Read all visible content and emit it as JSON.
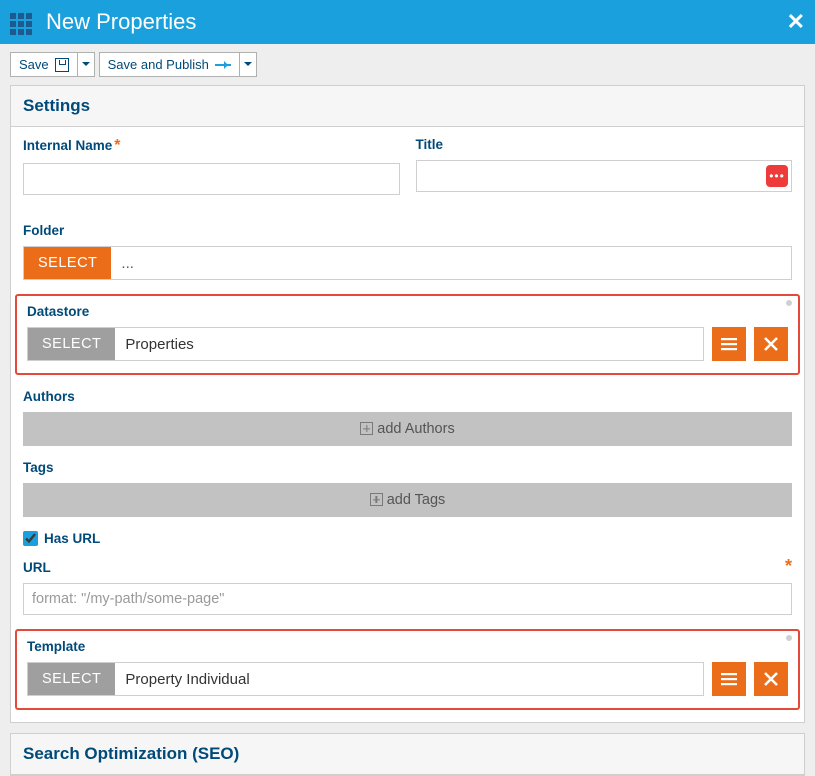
{
  "header": {
    "title": "New Properties"
  },
  "toolbar": {
    "save": "Save",
    "savePublish": "Save and Publish"
  },
  "panel": {
    "settings": "Settings",
    "seo": "Search Optimization (SEO)"
  },
  "fields": {
    "internalName": {
      "label": "Internal Name",
      "value": ""
    },
    "title": {
      "label": "Title",
      "value": ""
    },
    "folder": {
      "label": "Folder",
      "select": "SELECT",
      "value": "..."
    },
    "datastore": {
      "label": "Datastore",
      "select": "SELECT",
      "value": "Properties"
    },
    "authors": {
      "label": "Authors",
      "add": "add Authors"
    },
    "tags": {
      "label": "Tags",
      "add": "add Tags"
    },
    "hasUrl": {
      "label": "Has URL",
      "checked": true
    },
    "url": {
      "label": "URL",
      "placeholder": "format: \"/my-path/some-page\"",
      "value": ""
    },
    "template": {
      "label": "Template",
      "select": "SELECT",
      "value": "Property Individual"
    }
  }
}
